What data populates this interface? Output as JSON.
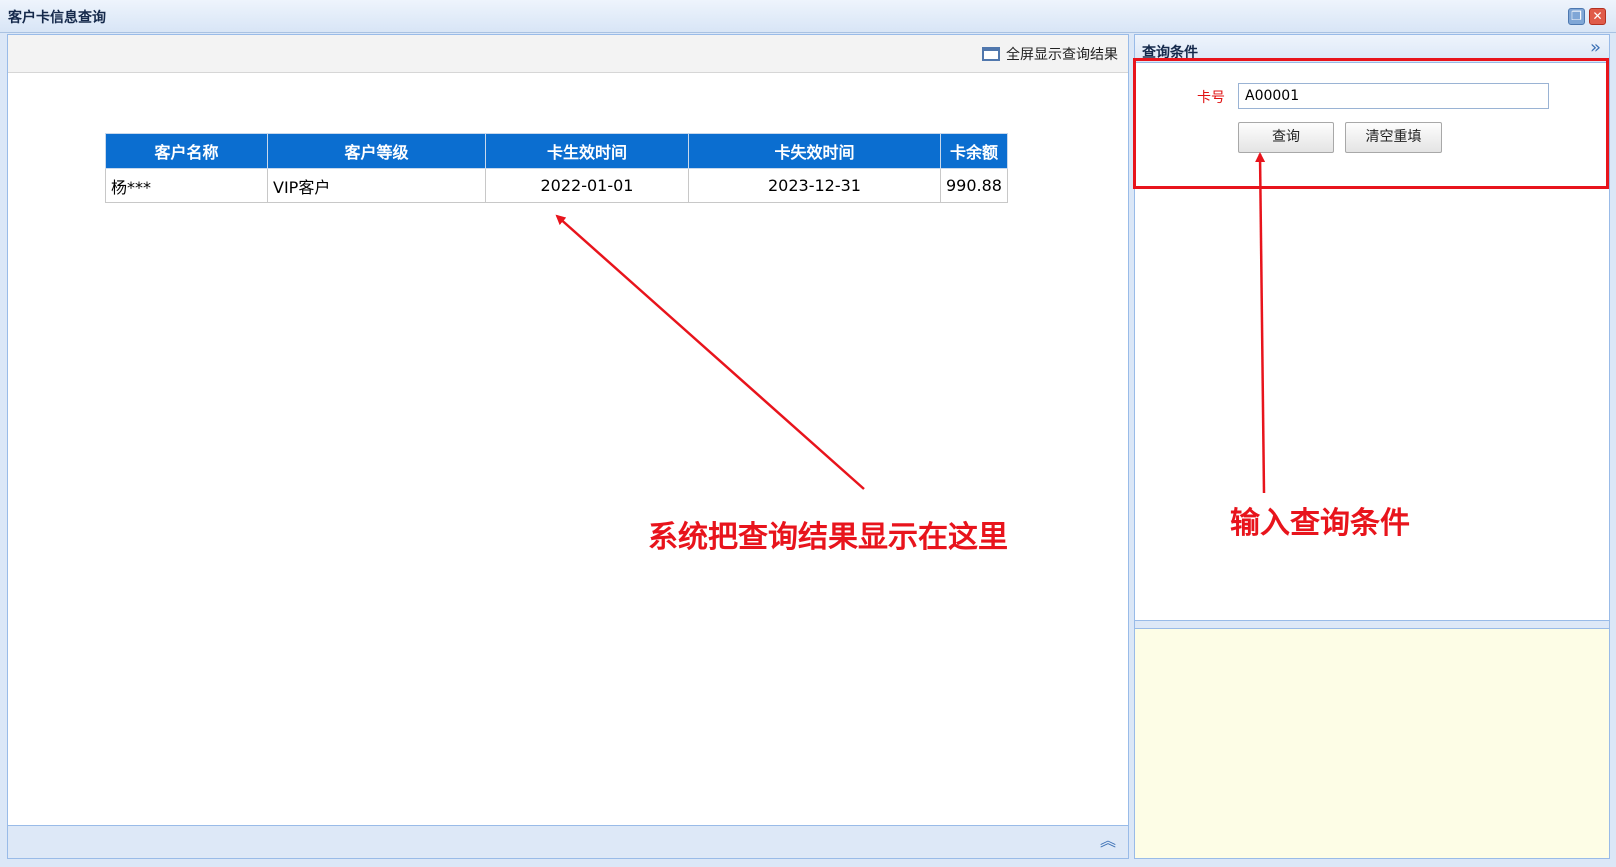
{
  "window": {
    "title": "客户卡信息查询"
  },
  "left_panel": {
    "fullscreen_label": "全屏显示查询结果"
  },
  "table": {
    "headers": [
      "客户名称",
      "客户等级",
      "卡生效时间",
      "卡失效时间",
      "卡余额"
    ],
    "rows": [
      [
        "杨***",
        "VIP客户",
        "2022-01-01",
        "2023-12-31",
        "990.88"
      ]
    ]
  },
  "right_panel": {
    "title": "查询条件",
    "card_label": "卡号",
    "card_value": "A00001",
    "query_button": "查询",
    "clear_button": "清空重填"
  },
  "annotations": {
    "results_note": "系统把查询结果显示在这里",
    "input_note": "输入查询条件"
  },
  "colors": {
    "header_blue": "#0b6ed0",
    "annotation_red": "#e8141c",
    "hint_bg": "#fdfde6"
  }
}
